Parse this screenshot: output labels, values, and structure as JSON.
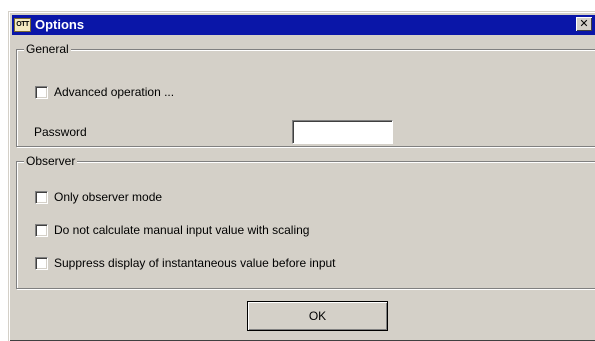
{
  "window": {
    "title": "Options",
    "icon_text": "OTT",
    "close_glyph": "✕"
  },
  "general": {
    "label": "General",
    "advanced_operation": {
      "label": "Advanced operation ...",
      "checked": false
    },
    "password_label": "Password",
    "password_value": ""
  },
  "observer": {
    "label": "Observer",
    "options": [
      {
        "label": "Only observer mode",
        "checked": false
      },
      {
        "label": "Do not calculate manual input value with scaling",
        "checked": false
      },
      {
        "label": "Suppress display of instantaneous value before input",
        "checked": false
      }
    ]
  },
  "buttons": {
    "ok_label": "OK"
  },
  "colors": {
    "titlebar": "#0a16a8",
    "dialog_face": "#d4d0c8"
  }
}
